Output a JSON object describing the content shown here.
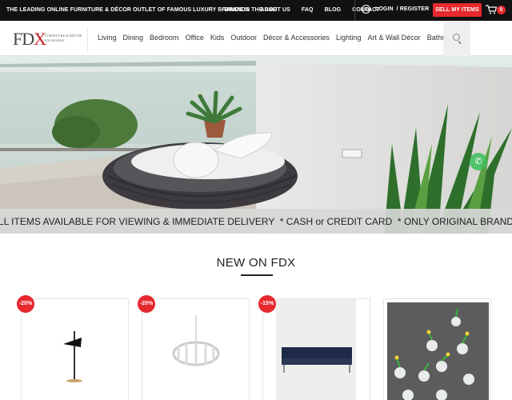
{
  "topbar": {
    "tagline": "THE LEADING ONLINE FURNITURE & DÉCOR OUTLET OF FAMOUS LUXURY BRANDS IN THE UAE",
    "links": [
      "BRANDS",
      "ABOUT US",
      "FAQ",
      "BLOG",
      "CONTACT"
    ],
    "login": "LOGIN",
    "register": "/ REGISTER",
    "sell_button": "SELL MY ITEMS",
    "cart_count": "0",
    "accent": "#e6292e"
  },
  "header": {
    "logo_text": "FD",
    "logo_x": "X",
    "logo_sub": "FURNITURE & DÉCOR EXCHANGE",
    "nav": [
      "Living",
      "Dining",
      "Bedroom",
      "Office",
      "Kids",
      "Outdoor",
      "Décor & Accessories",
      "Lighting",
      "Art & Wall Décor",
      "Bathroom"
    ]
  },
  "hero": {
    "banner_text": "ALL ITEMS AVAILABLE FOR VIEWING & IMMEDIATE DELIVERY  * CASH or CREDIT CARD  * ONLY ORIGINAL BRANDS"
  },
  "new_section": {
    "title": "NEW ON FDX",
    "products": [
      {
        "badge": "-20%",
        "image": "floor-lamp"
      },
      {
        "badge": "-20%",
        "image": "chandelier"
      },
      {
        "badge": "-15%",
        "image": "sofa"
      },
      {
        "badge": "",
        "image": "wall-flowers-art"
      }
    ]
  }
}
